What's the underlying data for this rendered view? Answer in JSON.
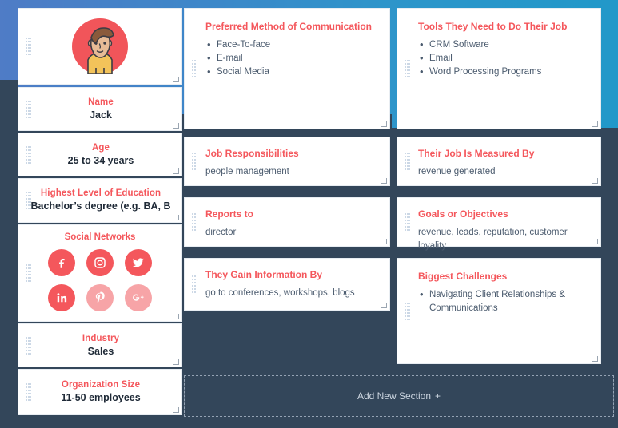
{
  "theme": {
    "accent": "#f4575c",
    "background": "#33465a",
    "band_start": "#4f7cc6",
    "band_end": "#2198c9",
    "card_bg": "#ffffff",
    "body_text": "#4b5b6e"
  },
  "profile": {
    "avatar_icon": "person-avatar-icon",
    "fields": [
      {
        "label": "Name",
        "value": "Jack"
      },
      {
        "label": "Age",
        "value": "25 to 34 years"
      },
      {
        "label": "Highest Level of Education",
        "value": "Bachelor’s degree (e.g. BA, B"
      },
      {
        "label": "Industry",
        "value": "Sales"
      },
      {
        "label": "Organization Size",
        "value": "11-50 employees"
      }
    ],
    "social": {
      "title": "Social Networks",
      "networks": [
        {
          "name": "facebook-icon",
          "label": "Facebook",
          "active": true
        },
        {
          "name": "instagram-icon",
          "label": "Instagram",
          "active": true
        },
        {
          "name": "twitter-icon",
          "label": "Twitter",
          "active": true
        },
        {
          "name": "linkedin-icon",
          "label": "LinkedIn",
          "active": true
        },
        {
          "name": "pinterest-icon",
          "label": "Pinterest",
          "active": false
        },
        {
          "name": "googleplus-icon",
          "label": "Google Plus",
          "active": false
        }
      ]
    }
  },
  "sections": [
    {
      "title": "Preferred Method of Communication",
      "type": "list",
      "items": [
        "Face-To-face",
        "E-mail",
        "Social Media"
      ]
    },
    {
      "title": "Tools They Need to Do Their Job",
      "type": "list",
      "items": [
        "CRM Software",
        "Email",
        "Word Processing Programs"
      ]
    },
    {
      "title": "Job Responsibilities",
      "type": "text",
      "text": "people management"
    },
    {
      "title": "Their Job Is Measured By",
      "type": "text",
      "text": "revenue generated"
    },
    {
      "title": "Reports to",
      "type": "text",
      "text": "director"
    },
    {
      "title": "Goals or Objectives",
      "type": "text",
      "text": "revenue, leads, reputation, customer loyality"
    },
    {
      "title": "They Gain Information By",
      "type": "text",
      "text": "go to conferences, workshops, blogs"
    },
    {
      "title": "Biggest Challenges",
      "type": "list",
      "items": [
        "Navigating Client Relationships & Communications"
      ]
    }
  ],
  "add_section": {
    "label": "Add New Section",
    "plus_icon": "plus-icon",
    "plus": "+"
  }
}
